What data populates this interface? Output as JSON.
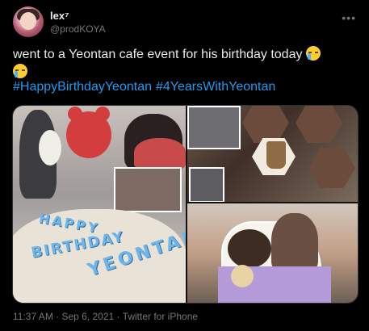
{
  "user": {
    "display_name": "lex⁷",
    "handle": "@prodKOYA"
  },
  "tweet": {
    "text": "went to a Yeontan cafe event for his birthday today",
    "hashtags": [
      "#HappyBirthdayYeontan",
      "#4YearsWithYeontan"
    ],
    "emoji": [
      "loudly-crying-face",
      "loudly-crying-face"
    ]
  },
  "media": {
    "cake_lines": [
      "HAPPY",
      "BIRTHDAY",
      "YEONTAN"
    ]
  },
  "footer": {
    "time": "11:37 AM",
    "separator": " · ",
    "date": "Sep 6, 2021",
    "source": "Twitter for iPhone"
  },
  "colors": {
    "background": "#000000",
    "text": "#e7e9ea",
    "secondary": "#71767b",
    "link": "#1d9bf0"
  },
  "icons": {
    "more": "more-horizontal-icon"
  }
}
